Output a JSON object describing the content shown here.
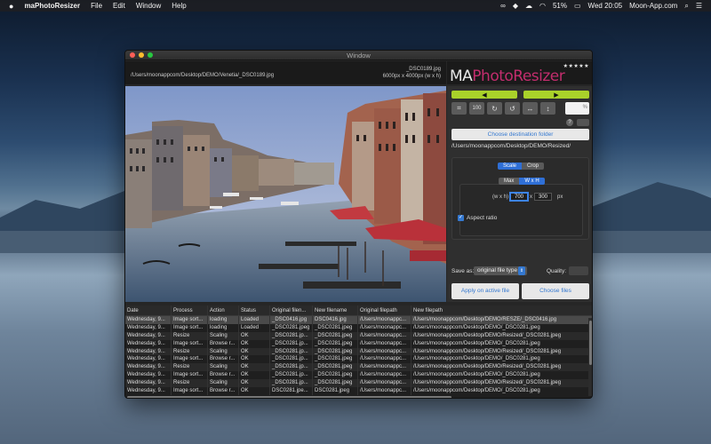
{
  "menubar": {
    "app_name": "maPhotoResizer",
    "items": [
      "File",
      "Edit",
      "Window",
      "Help"
    ],
    "battery": "51%",
    "clock": "Wed 20:05",
    "site": "Moon-App.com"
  },
  "window": {
    "title": "Window"
  },
  "image_header": {
    "path": "/Users/moonappcom/Desktop/DEMO/Venetia/_DSC0189.jpg",
    "filename": "_DSC0189.jpg",
    "dimensions": "6000px x 4000px (w x h)"
  },
  "logo": {
    "ma": "MA",
    "photo": "Photo",
    "resizer": "Resizer",
    "stars": "★★★★★"
  },
  "panel": {
    "prev_label": "◀",
    "next_label": "▶",
    "tools": [
      "crop",
      "100",
      "rotate-right",
      "rotate-left",
      "flip-horizontal",
      "flip-vertical"
    ],
    "percent_label": "%",
    "help_label": "?",
    "choose_dest_label": "Choose destination folder",
    "dest_path": "/Users/moonappcom/Desktop/DEMO/Resized/",
    "mode_tabs": [
      "Scale",
      "Crop"
    ],
    "active_mode": "Scale",
    "size_tabs": [
      "Max",
      "W x H"
    ],
    "active_size": "W x H",
    "wh_label": "(w x h)",
    "width": "700",
    "x_label": "x",
    "height": "300",
    "unit": "px",
    "aspect_label": "Aspect ratio",
    "aspect_checked": true,
    "save_as_label": "Save as:",
    "save_as_value": "original file type",
    "quality_label": "Quality:",
    "apply_label": "Apply on active file",
    "choose_files_label": "Choose files"
  },
  "table": {
    "columns": [
      "Date",
      "Process",
      "Action",
      "Status",
      "Original filen...",
      "New filename",
      "Original filepath",
      "New filepath"
    ],
    "rows": [
      [
        "Wednesday, 9...",
        "Image sort...",
        "loading",
        "Loaded",
        "_DSC0416.jpg",
        "DSC0416.jpg",
        "/Users/moonappc...",
        "/Users/moonappcom/Desktop/DEMO/RESZE/_DSC0416.jpg"
      ],
      [
        "Wednesday, 9...",
        "Image sort...",
        "loading",
        "Loaded",
        "_DSC0281.jpeg",
        "_DSC0281.jpeg",
        "/Users/moonappc...",
        "/Users/moonappcom/Desktop/DEMO/_DSC0281.jpeg"
      ],
      [
        "Wednesday, 9...",
        "Resize",
        "Scaling",
        "OK",
        "_DSC0281.jp...",
        "_DSC0281.jpeg",
        "/Users/moonappc...",
        "/Users/moonappcom/Desktop/DEMO/Resized/_DSC0281.jpeg"
      ],
      [
        "Wednesday, 9...",
        "Image sort...",
        "Browse r...",
        "OK",
        "_DSC0281.jp...",
        "_DSC0281.jpeg",
        "/Users/moonappc...",
        "/Users/moonappcom/Desktop/DEMO/_DSC0281.jpeg"
      ],
      [
        "Wednesday, 9...",
        "Resize",
        "Scaling",
        "OK",
        "_DSC0281.jp...",
        "_DSC0281.jpeg",
        "/Users/moonappc...",
        "/Users/moonappcom/Desktop/DEMO/Resized/_DSC0281.jpeg"
      ],
      [
        "Wednesday, 9...",
        "Image sort...",
        "Browse r...",
        "OK",
        "_DSC0281.jp...",
        "_DSC0281.jpeg",
        "/Users/moonappc...",
        "/Users/moonappcom/Desktop/DEMO/_DSC0281.jpeg"
      ],
      [
        "Wednesday, 9...",
        "Resize",
        "Scaling",
        "OK",
        "_DSC0281.jp...",
        "_DSC0281.jpeg",
        "/Users/moonappc...",
        "/Users/moonappcom/Desktop/DEMO/Resized/_DSC0281.jpeg"
      ],
      [
        "Wednesday, 9...",
        "Image sort...",
        "Browse r...",
        "OK",
        "_DSC0281.jp...",
        "_DSC0281.jpeg",
        "/Users/moonappc...",
        "/Users/moonappcom/Desktop/DEMO/_DSC0281.jpeg"
      ],
      [
        "Wednesday, 9...",
        "Resize",
        "Scaling",
        "OK",
        "_DSC0281.jp...",
        "_DSC0281.jpeg",
        "/Users/moonappc...",
        "/Users/moonappcom/Desktop/DEMO/Resized/_DSC0281.jpeg"
      ],
      [
        "Wednesday, 9...",
        "Image sort...",
        "Browse r...",
        "OK",
        "DSC0281.jpe...",
        "DSC0281.jpeg",
        "/Users/moonappc...",
        "/Users/moonappcom/Desktop/DEMO/_DSC0281.jpeg"
      ]
    ]
  },
  "colors": {
    "accent_green": "#a9d12a",
    "accent_blue": "#3478d0",
    "brand_pink": "#c22d6d"
  }
}
